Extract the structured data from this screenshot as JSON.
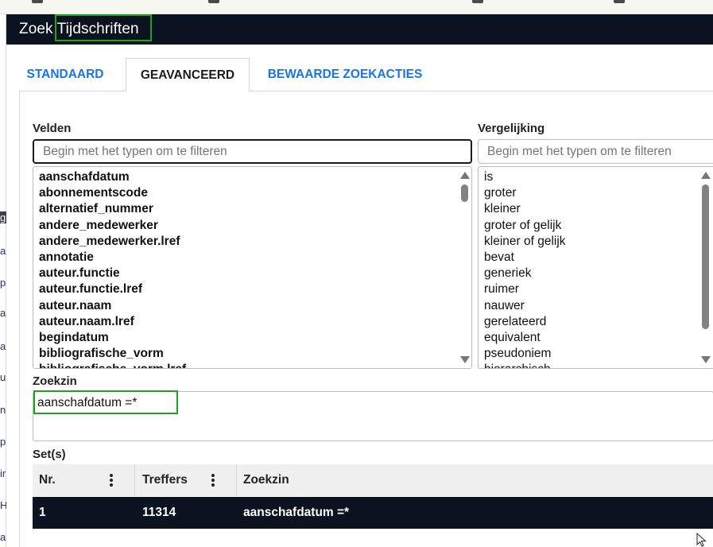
{
  "window": {
    "title": "Zoek Tijdschriften"
  },
  "tabs": [
    {
      "label": "STANDAARD",
      "active": false
    },
    {
      "label": "GEAVANCEERD",
      "active": true
    },
    {
      "label": "BEWAARDE ZOEKACTIES",
      "active": false
    }
  ],
  "velden": {
    "label": "Velden",
    "filter_placeholder": "Begin met het typen om te filteren",
    "filter_value": "",
    "items": [
      "aanschafdatum",
      "abonnementscode",
      "alternatief_nummer",
      "andere_medewerker",
      "andere_medewerker.lref",
      "annotatie",
      "auteur.functie",
      "auteur.functie.lref",
      "auteur.naam",
      "auteur.naam.lref",
      "begindatum",
      "bibliografische_vorm",
      "bibliografische_vorm.lref"
    ]
  },
  "vergelijking": {
    "label": "Vergelijking",
    "filter_placeholder": "Begin met het typen om te filteren",
    "filter_value": "",
    "items": [
      "is",
      "groter",
      "kleiner",
      "groter of gelijk",
      "kleiner of gelijk",
      "bevat",
      "generiek",
      "ruimer",
      "nauwer",
      "gerelateerd",
      "equivalent",
      "pseudoniem",
      "hierarchisch"
    ]
  },
  "zoekzin": {
    "label": "Zoekzin",
    "value": "aanschafdatum =*"
  },
  "sets": {
    "label": "Set(s)",
    "columns": [
      "Nr.",
      "Treffers",
      "Zoekzin"
    ],
    "rows": [
      {
        "nr": "1",
        "treffers": "11314",
        "zoekzin": "aanschafdatum =*"
      }
    ]
  },
  "colors": {
    "titlebar": "#0b1220",
    "tab_blue": "#1a73e8",
    "highlight_green": "#1fa31f",
    "selected_row": "#0b1220"
  },
  "left_strip_glyphs": [
    "g",
    "ap",
    "p",
    "ap",
    "ap",
    "u",
    "ni",
    "p",
    "ir",
    "H",
    "a"
  ]
}
